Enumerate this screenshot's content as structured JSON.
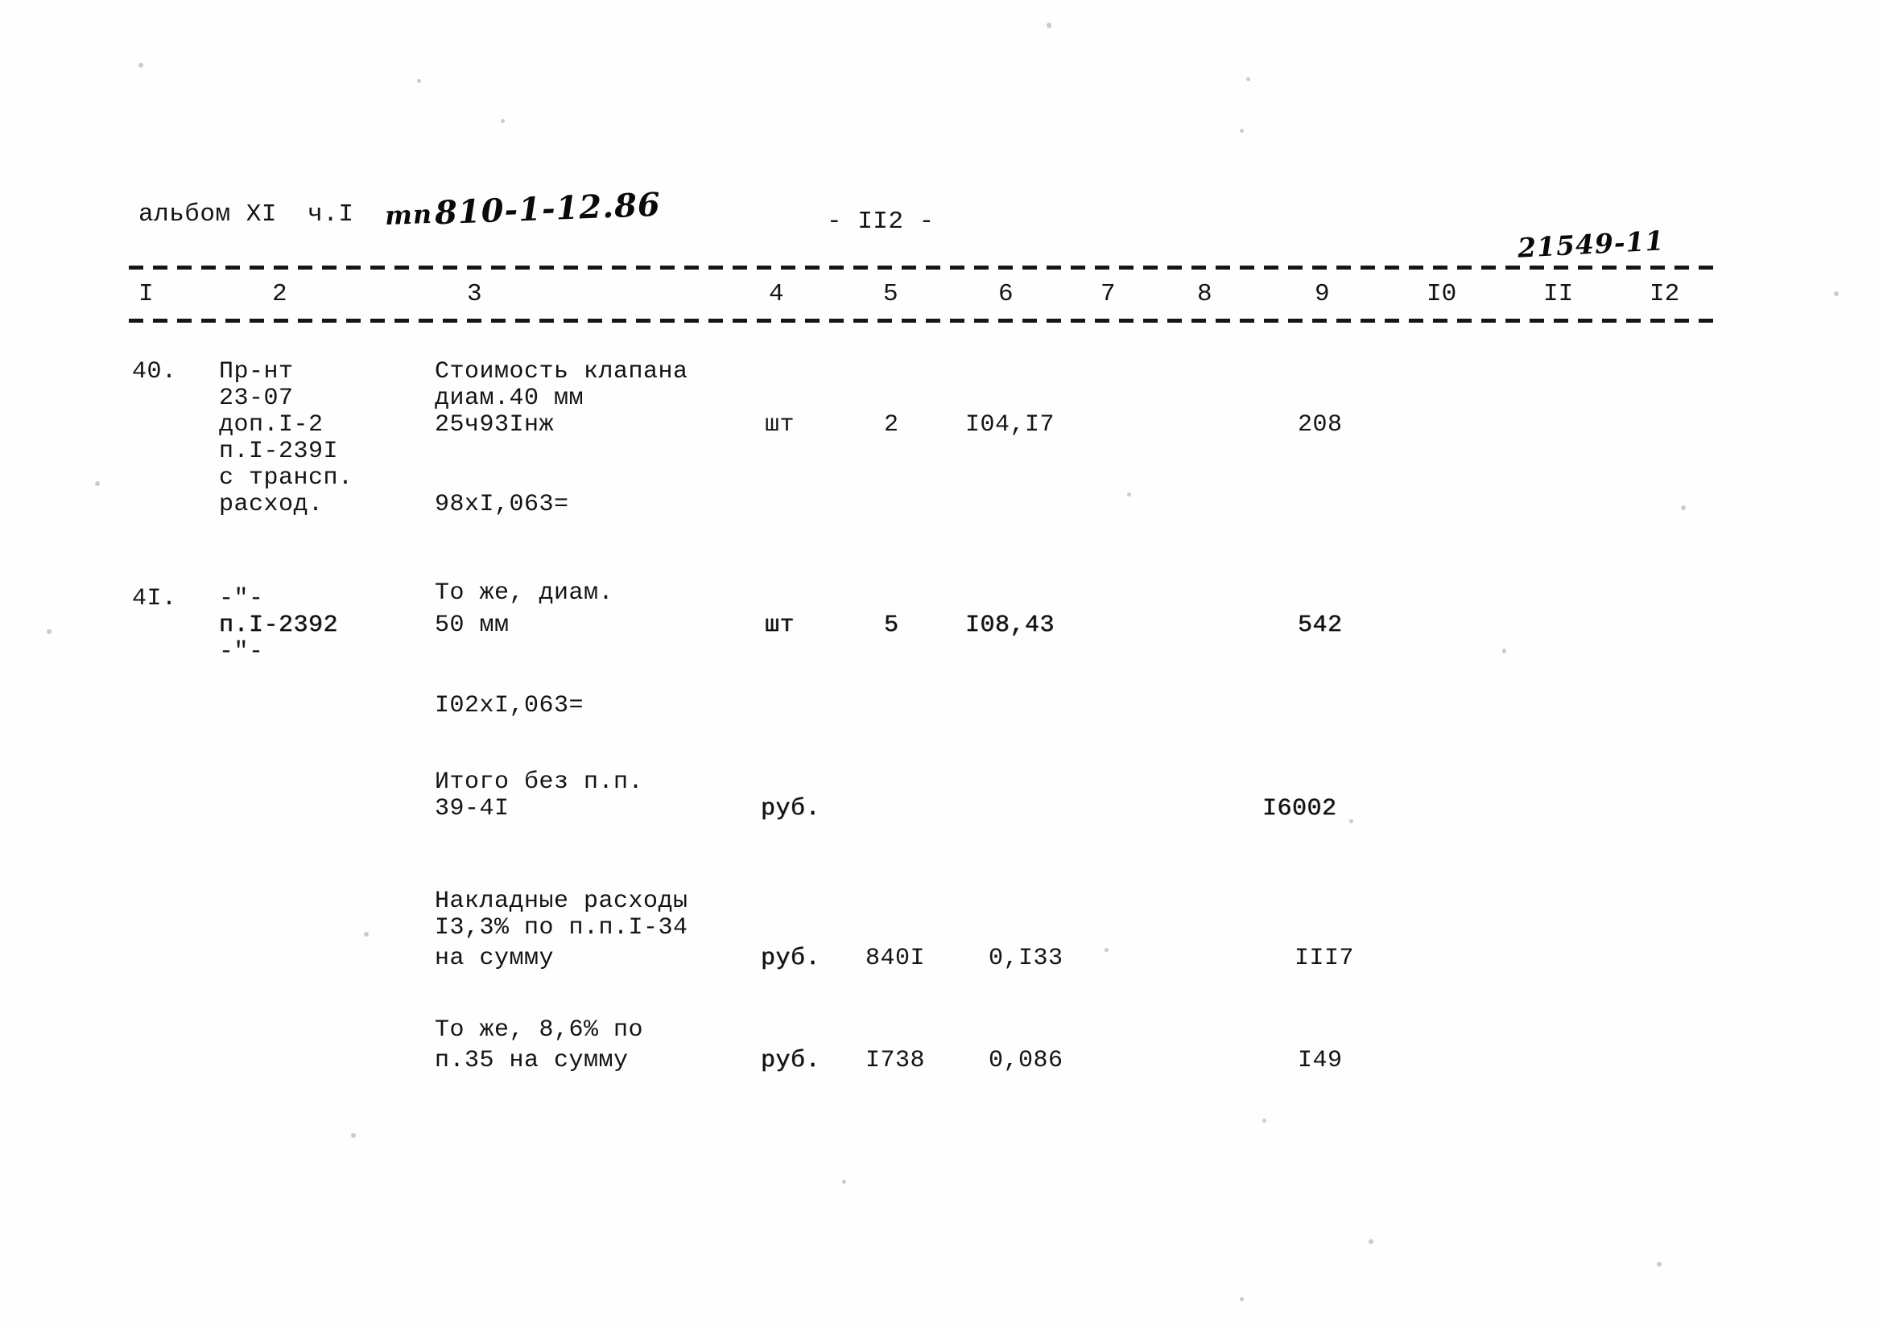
{
  "page": {
    "album_line": "альбом XI  ч.I",
    "album_handwritten_code": "810-1-12.86",
    "album_handwritten_prefix": "тп",
    "page_number": "- II2 -",
    "stamp_handwritten": "21549-11"
  },
  "table": {
    "column_headers": [
      "I",
      "2",
      "3",
      "4",
      "5",
      "6",
      "7",
      "8",
      "9",
      "I0",
      "II",
      "I2"
    ],
    "rows": [
      {
        "num": "40.",
        "code_lines": [
          "Пр-нт",
          "23-07",
          "доп.I-2",
          "п.I-239I",
          "с трансп.",
          "расход."
        ],
        "desc_lines": [
          "Стоимость клапана",
          "диам.40 мм",
          "25ч93Iнж"
        ],
        "calc_line": "98xI,063=",
        "unit": "шт",
        "qty": "2",
        "price": "I04,I7",
        "total": "208"
      },
      {
        "num": "4I.",
        "code_lines": [
          "-\"-",
          "п.I-2392",
          "-\"-"
        ],
        "desc_lines": [
          "То же, диам.",
          "50 мм"
        ],
        "calc_line": "I02xI,063=",
        "unit": "шт",
        "qty": "5",
        "price": "I08,43",
        "total": "542"
      },
      {
        "num": "",
        "code_lines": [],
        "desc_lines": [
          "Итого без п.п.",
          "39-4I"
        ],
        "calc_line": "",
        "unit": "руб.",
        "qty": "",
        "price": "",
        "total": "I6002"
      },
      {
        "num": "",
        "code_lines": [],
        "desc_lines": [
          "Накладные расходы",
          "I3,3% по п.п.I-34",
          "на сумму"
        ],
        "calc_line": "",
        "unit": "руб.",
        "qty": "840I",
        "price": "0,I33",
        "total": "III7"
      },
      {
        "num": "",
        "code_lines": [],
        "desc_lines": [
          "То же, 8,6% по",
          "п.35 на сумму"
        ],
        "calc_line": "",
        "unit": "руб.",
        "qty": "I738",
        "price": "0,086",
        "total": "I49"
      }
    ]
  }
}
